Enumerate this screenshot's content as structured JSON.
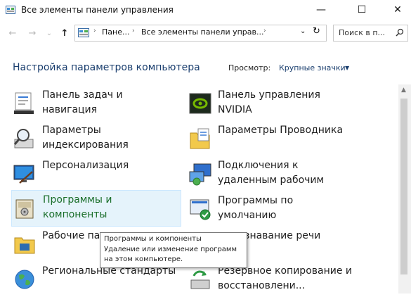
{
  "window": {
    "title": "Все элементы панели управления",
    "minimize": "—",
    "maximize": "☐",
    "close": "✕"
  },
  "nav": {
    "back": "←",
    "forward": "→",
    "recent": "⌄",
    "up": "↑",
    "breadcrumbs": [
      "Пане...",
      "Все элементы панели управ..."
    ],
    "crumb_sep": "›",
    "dropdown": "⌄",
    "refresh": "↻",
    "search_placeholder": "Поиск в п..."
  },
  "header": {
    "title": "Настройка параметров компьютера",
    "view_label": "Просмотр:",
    "view_value": "Крупные значки",
    "view_arrow": "▼"
  },
  "items": [
    {
      "label": "Панель задач и\nнавигация",
      "icon": "taskbar-icon"
    },
    {
      "label": "Панель управления\nNVIDIA",
      "icon": "nvidia-icon"
    },
    {
      "label": "Параметры\nиндексирования",
      "icon": "indexing-icon"
    },
    {
      "label": "Параметры Проводника",
      "icon": "folder-options-icon"
    },
    {
      "label": "Персонализация",
      "icon": "personalization-icon"
    },
    {
      "label": "Подключения к\nудаленным рабочим",
      "icon": "remote-desktop-icon"
    },
    {
      "label": "Программы и\nкомпоненты",
      "icon": "programs-icon"
    },
    {
      "label": "Программы по\nумолчанию",
      "icon": "default-programs-icon"
    },
    {
      "label": "Рабочие па",
      "icon": "work-folders-icon"
    },
    {
      "label": "знавание речи",
      "icon": "speech-icon"
    },
    {
      "label": "Региональные стандарты",
      "icon": "region-icon"
    },
    {
      "label": "Резервное копирование и\nвосстановлени...",
      "icon": "backup-icon"
    }
  ],
  "tooltip": {
    "line1": "Программы и компоненты",
    "line2": "Удаление или изменение программ",
    "line3": "на этом компьютере."
  }
}
